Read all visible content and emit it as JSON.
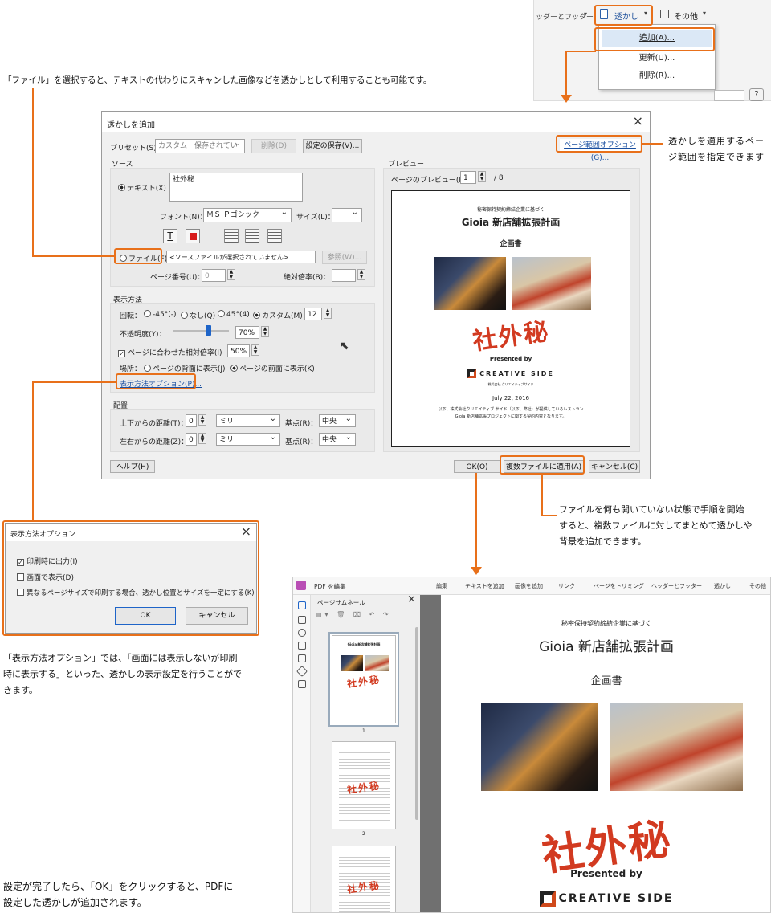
{
  "menu": {
    "toolbar_headfoot": "ッダーとフッター",
    "toolbar_watermark": "透かし",
    "toolbar_other": "その他",
    "items": [
      "追加(A)...",
      "更新(U)...",
      "削除(R)..."
    ]
  },
  "captions": {
    "file": "「ファイル」を選択すると、テキストの代わりにスキャンした画像などを透かしとして利用することも可能です。",
    "range": [
      "透かしを適用するペー",
      "ジ範囲を指定できます"
    ],
    "multi": [
      "ファイルを何も開いていない状態で手順を開始",
      "すると、複数ファイルに対してまとめて透かしや",
      "背景を追加できます。"
    ],
    "option": [
      "「表示方法オプション」では、「画面には表示しないが印刷",
      "時に表示する」といった、透かしの表示設定を行うことがで",
      "きます。"
    ],
    "ok": [
      "設定が完了したら、「OK」をクリックすると、PDFに",
      "設定した透かしが追加されます。"
    ]
  },
  "dialog": {
    "title": "透かしを追加",
    "preset_label": "プリセット(S)：",
    "preset_value": "カスタム－保存されてい",
    "delete_btn": "削除(D)",
    "save_btn": "設定の保存(V)...",
    "range_btn": "ページ範囲オプション(G)...",
    "source_label": "ソース",
    "text_radio": "テキスト(X)",
    "text_value": "社外秘",
    "font_label": "フォント(N)：",
    "font_value": "ＭＳ Ｐゴシック",
    "size_label": "サイズ(L)：",
    "file_radio": "ファイル(F)",
    "file_value": "<ソースファイルが選択されていません>",
    "browse_btn": "参照(W)...",
    "pageno_label": "ページ番号(U)：",
    "pageno_value": "0",
    "absscale_label": "絶対倍率(B)：",
    "display_label": "表示方法",
    "rotation_label": "回転：",
    "rot_options": [
      "-45°(-)",
      "なし(Q)",
      "45°(4)",
      "カスタム(M)"
    ],
    "rot_custom": "12",
    "opacity_label": "不透明度(Y)：",
    "opacity_value": "70%",
    "opacity_level": 0.7,
    "relscale_label": "ページに合わせた相対倍率(I)",
    "relscale_value": "50%",
    "place_label": "場所：",
    "place_back": "ページの背面に表示(J)",
    "place_front": "ページの前面に表示(K)",
    "option_link": "表示方法オプション(P)...",
    "layout_label": "配置",
    "vdist_label": "上下からの距離(T)：",
    "hdist_label": "左右からの距離(Z)：",
    "dist_value": "0",
    "unit": "ミリ",
    "base_label": "基点(R)：",
    "base_value": "中央",
    "help_btn": "ヘルプ(H)",
    "ok_btn": "OK(O)",
    "multi_btn": "複数ファイルに適用(A)",
    "cancel_btn": "キャンセル(C)",
    "preview_label": "プレビュー",
    "page_preview_label": "ページのプレビュー(E)",
    "page_num": "1",
    "page_total": "/ 8"
  },
  "doc": {
    "subtitle": "秘密保持契約締結企業に基づく",
    "title": "Gioia 新店舗拡張計画",
    "heading": "企画書",
    "watermark": "社外秘",
    "presented": "Presented by",
    "logo_text": "CREATIVE SIDE",
    "logo_sub": "株式会社 クリエイティブサイド",
    "date": "July 22, 2016",
    "body": [
      "以下、株式会社クリエイティブ サイド（以下、弊社）が提供しているレストラン",
      "Gioia 新店舗拡張プロジェクトに関する契約内容となります。"
    ]
  },
  "options_dialog": {
    "title": "表示方法オプション",
    "print": "印刷時に出力(I)",
    "screen": "画面で表示(D)",
    "fixed": "異なるページサイズで印刷する場合、透かし位置とサイズを一定にする(K)",
    "ok": "OK",
    "cancel": "キャンセル"
  },
  "acrobat": {
    "edit_label": "PDF を編集",
    "tools": [
      "編集",
      "テキストを追加",
      "画像を追加",
      "リンク",
      "ページをトリミング",
      "ヘッダーとフッター",
      "透かし",
      "その他"
    ],
    "thumb_label": "ページサムネール",
    "thumb_pages": [
      "1",
      "2"
    ]
  }
}
